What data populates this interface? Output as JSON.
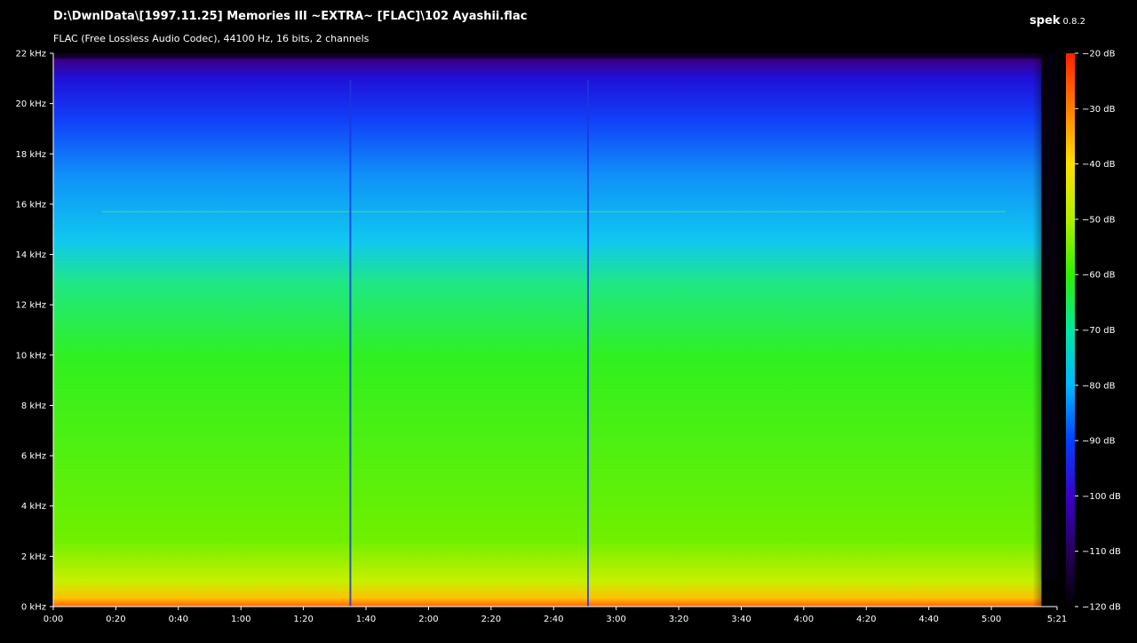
{
  "header": {
    "file_path": "D:\\DwnlData\\[1997.11.25] Memories III ~EXTRA~ [FLAC]\\102 Ayashii.flac",
    "audio_info": "FLAC (Free Lossless Audio Codec), 44100 Hz, 16 bits, 2 channels",
    "app_name": "spek",
    "app_version": "0.8.2"
  },
  "colors": {
    "background": "#000000",
    "text": "#ffffff",
    "axis": "#ffffff",
    "palette_low_to_high": [
      "#000000",
      "#20004a",
      "#3a00c8",
      "#0050ff",
      "#00c8ff",
      "#00e8a0",
      "#30f000",
      "#b0f000",
      "#ffe000",
      "#ff8000",
      "#ff2000"
    ]
  },
  "chart_data": {
    "type": "heatmap",
    "title": "D:\\DwnlData\\[1997.11.25] Memories III ~EXTRA~ [FLAC]\\102 Ayashii.flac",
    "subtitle": "FLAC (Free Lossless Audio Codec), 44100 Hz, 16 bits, 2 channels",
    "x_axis": {
      "unit": "time (m:ss)",
      "range_seconds": [
        0,
        321
      ],
      "tick_values_seconds": [
        0,
        20,
        40,
        60,
        80,
        100,
        120,
        140,
        160,
        180,
        200,
        220,
        240,
        260,
        280,
        300,
        321
      ],
      "tick_labels": [
        "0:00",
        "0:20",
        "0:40",
        "1:00",
        "1:20",
        "1:40",
        "2:00",
        "2:20",
        "2:40",
        "3:00",
        "3:20",
        "3:40",
        "4:00",
        "4:20",
        "4:40",
        "5:00",
        "5:21"
      ]
    },
    "y_axis": {
      "unit": "kHz",
      "range": [
        0,
        22
      ],
      "tick_values": [
        0,
        2,
        4,
        6,
        8,
        10,
        12,
        14,
        16,
        18,
        20,
        22
      ],
      "tick_labels": [
        "0 kHz",
        "2 kHz",
        "4 kHz",
        "6 kHz",
        "8 kHz",
        "10 kHz",
        "12 kHz",
        "14 kHz",
        "16 kHz",
        "18 kHz",
        "20 kHz",
        "22 kHz"
      ]
    },
    "color_scale": {
      "unit": "dB",
      "range": [
        -120,
        -20
      ],
      "tick_values": [
        -20,
        -30,
        -40,
        -50,
        -60,
        -70,
        -80,
        -90,
        -100,
        -110,
        -120
      ],
      "tick_labels": [
        "−20 dB",
        "−30 dB",
        "−40 dB",
        "−50 dB",
        "−60 dB",
        "−70 dB",
        "−80 dB",
        "−90 dB",
        "−100 dB",
        "−110 dB",
        "−120 dB"
      ]
    },
    "features": {
      "signal_end_seconds": 316,
      "lowpass_cutoff_khz": 21.8,
      "narrow_tone_khz": 15.7,
      "transient_dips_seconds": [
        95,
        171
      ],
      "approx_level_by_band_db": [
        {
          "band_khz": [
            0,
            1
          ],
          "db": -35
        },
        {
          "band_khz": [
            1,
            6
          ],
          "db": -58
        },
        {
          "band_khz": [
            6,
            12
          ],
          "db": -65
        },
        {
          "band_khz": [
            12,
            16
          ],
          "db": -75
        },
        {
          "band_khz": [
            16,
            20
          ],
          "db": -85
        },
        {
          "band_khz": [
            20,
            22
          ],
          "db": -100
        }
      ]
    }
  }
}
